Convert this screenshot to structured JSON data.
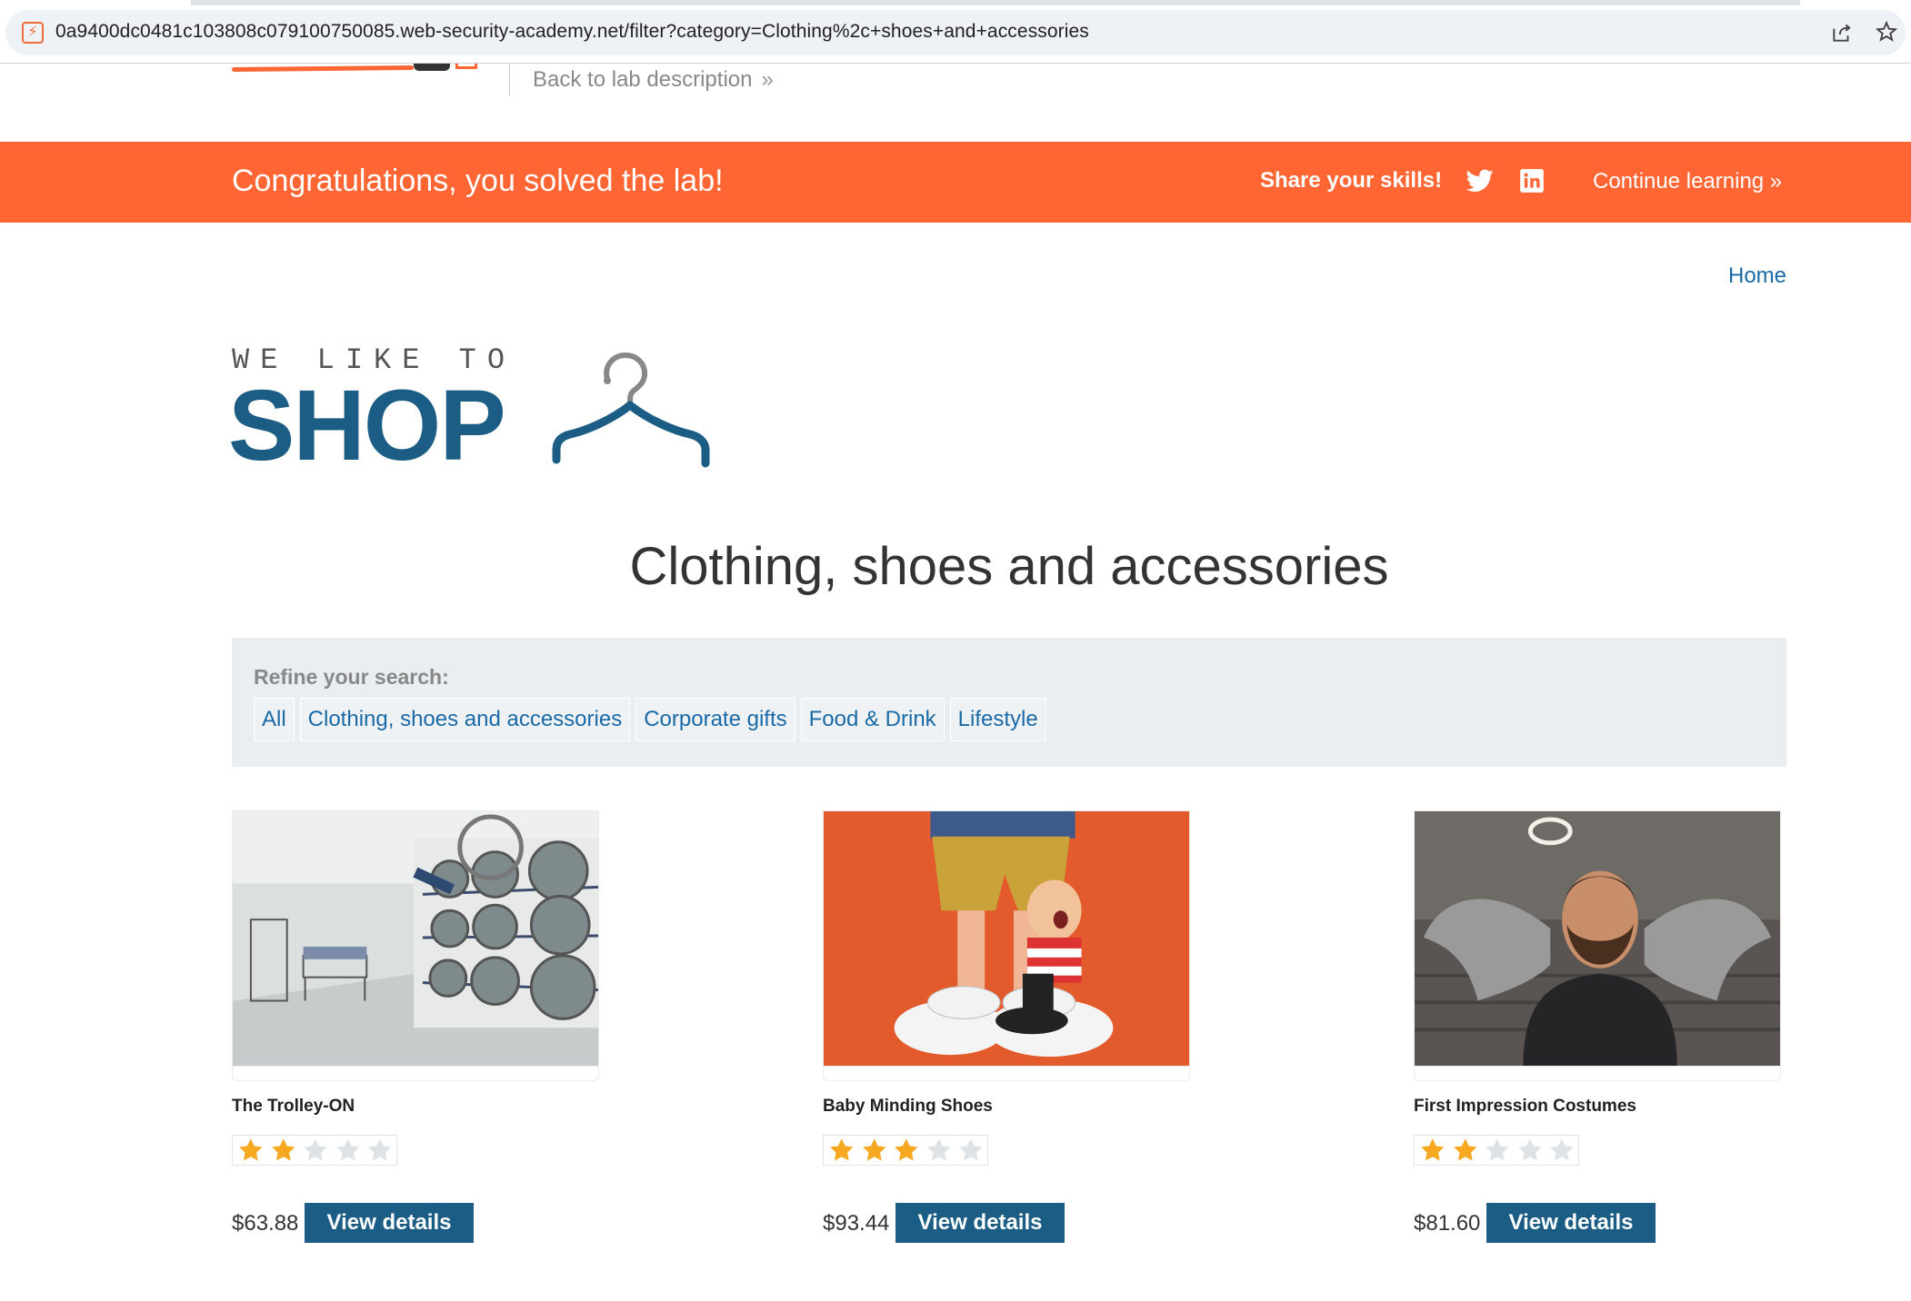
{
  "browser": {
    "url": "0a9400dc0481c103808c079100750085.web-security-academy.net/filter?category=Clothing%2c+shoes+and+accessories"
  },
  "academy_header": {
    "back_link": "Back to lab description"
  },
  "banner": {
    "message": "Congratulations, you solved the lab!",
    "share_label": "Share your skills!",
    "continue_label": "Continue learning",
    "color": "#ff6633"
  },
  "nav": {
    "home": "Home"
  },
  "logo": {
    "top_text": "WE LIKE TO",
    "main_text": "SHOP",
    "color": "#1c5d85"
  },
  "page": {
    "title": "Clothing, shoes and accessories"
  },
  "filter": {
    "label": "Refine your search:",
    "categories": [
      "All",
      "Clothing, shoes and accessories",
      "Corporate gifts",
      "Food & Drink",
      "Lifestyle"
    ]
  },
  "products": [
    {
      "name": "The Trolley-ON",
      "rating": 2,
      "max_rating": 5,
      "price": "$63.88",
      "button": "View details",
      "image_icon": "laundromat-image"
    },
    {
      "name": "Baby Minding Shoes",
      "rating": 3,
      "max_rating": 5,
      "price": "$93.44",
      "button": "View details",
      "image_icon": "giant-shoes-image"
    },
    {
      "name": "First Impression Costumes",
      "rating": 2,
      "max_rating": 5,
      "price": "$81.60",
      "button": "View details",
      "image_icon": "angel-costume-image"
    }
  ]
}
